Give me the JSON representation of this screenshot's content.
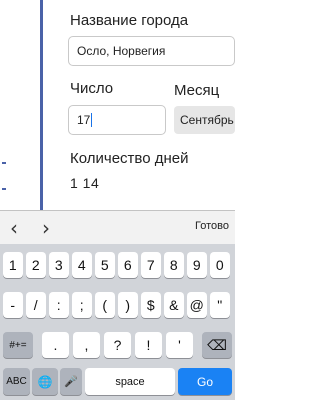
{
  "form": {
    "city_label": "Название города",
    "city_value": "Осло, Норвегия",
    "number_label": "Число",
    "number_value": "17",
    "month_label": "Месяц",
    "month_value": "Сентябрь",
    "days_label": "Количество дней",
    "days_value": "1 14"
  },
  "keyboard": {
    "toolbar": {
      "prev": "‹",
      "next": "›",
      "done": "Готово"
    },
    "row1": [
      "1",
      "2",
      "3",
      "4",
      "5",
      "6",
      "7",
      "8",
      "9",
      "0"
    ],
    "row2": [
      "-",
      "/",
      ":",
      ";",
      "(",
      ")",
      "$",
      "&",
      "@",
      "\""
    ],
    "row3_left": "#+=",
    "row3": [
      ".",
      ",",
      "?",
      "!",
      "'"
    ],
    "row3_right": "⌫",
    "row4": {
      "abc": "ABC",
      "globe": "🌐",
      "mic": "🎤",
      "space": "space",
      "go": "Go"
    }
  }
}
